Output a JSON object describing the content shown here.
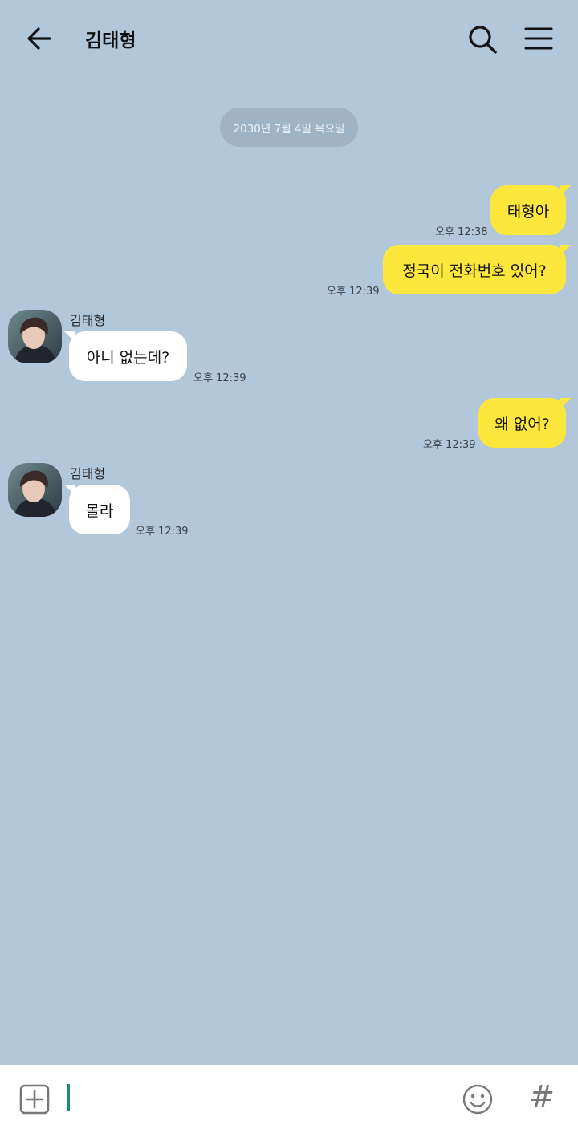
{
  "header": {
    "title": "김태형",
    "back_icon": "arrow-left-icon",
    "search_icon": "search-icon",
    "menu_icon": "hamburger-menu-icon"
  },
  "date_divider": "2030년 7월 4일 목요일",
  "colors": {
    "background": "#b2c7da",
    "my_bubble": "#fee73c",
    "their_bubble": "#ffffff",
    "date_pill": "#a0b3c3"
  },
  "messages": [
    {
      "from": "me",
      "text": "태형아",
      "time": "오후 12:38"
    },
    {
      "from": "me",
      "text": "정국이 전화번호 있어?",
      "time": "오후 12:39"
    },
    {
      "from": "them",
      "sender": "김태형",
      "text": "아니 없는데?",
      "time": "오후 12:39"
    },
    {
      "from": "me",
      "text": "왜 없어?",
      "time": "오후 12:39"
    },
    {
      "from": "them",
      "sender": "김태형",
      "text": "몰라",
      "time": "오후 12:39"
    }
  ],
  "composer": {
    "add_icon": "plus-square-icon",
    "emoji_icon": "smiley-icon",
    "hash_icon": "hashtag-icon",
    "hash_label": "#"
  }
}
